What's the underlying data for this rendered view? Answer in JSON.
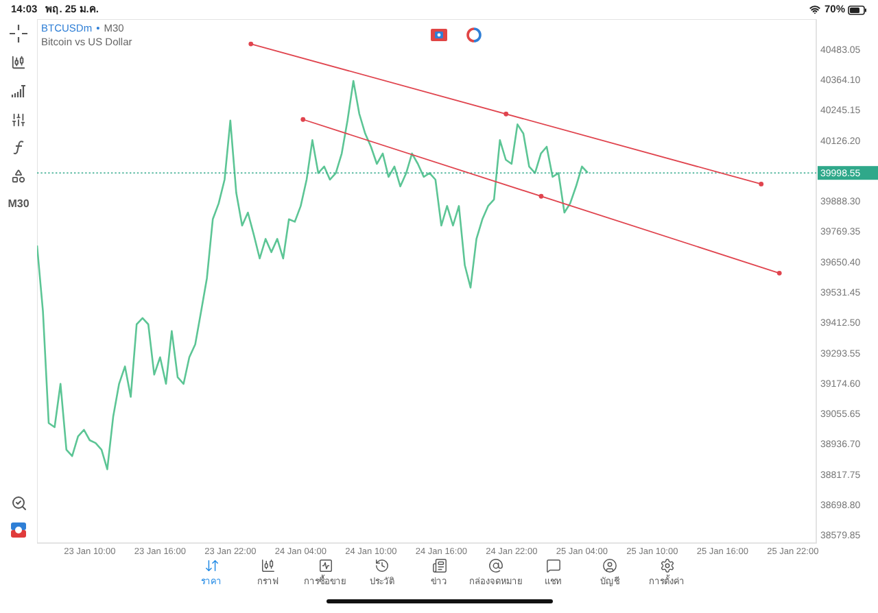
{
  "status_bar": {
    "time": "14:03",
    "date": "พฤ. 25 ม.ค.",
    "battery": "70%"
  },
  "toolbar": {
    "timeframe": "M30"
  },
  "chart": {
    "symbol": "BTCUSDm",
    "separator": "•",
    "period": "M30",
    "description": "Bitcoin vs US Dollar",
    "current_price": "39998.55",
    "chart_data": {
      "type": "line",
      "ylim": [
        38548,
        40601
      ],
      "yticks": [
        {
          "value": 40483.05,
          "label": "40483.05"
        },
        {
          "value": 40364.1,
          "label": "40364.10"
        },
        {
          "value": 40245.15,
          "label": "40245.15"
        },
        {
          "value": 40126.2,
          "label": "40126.20"
        },
        {
          "value": 39888.3,
          "label": "39888.30"
        },
        {
          "value": 39769.35,
          "label": "39769.35"
        },
        {
          "value": 39650.4,
          "label": "39650.40"
        },
        {
          "value": 39531.45,
          "label": "39531.45"
        },
        {
          "value": 39412.5,
          "label": "39412.50"
        },
        {
          "value": 39293.55,
          "label": "39293.55"
        },
        {
          "value": 39174.6,
          "label": "39174.60"
        },
        {
          "value": 39055.65,
          "label": "39055.65"
        },
        {
          "value": 38936.7,
          "label": "38936.70"
        },
        {
          "value": 38817.75,
          "label": "38817.75"
        },
        {
          "value": 38698.8,
          "label": "38698.80"
        },
        {
          "value": 38579.85,
          "label": "38579.85"
        }
      ],
      "categories": [
        null,
        null,
        null,
        null,
        null,
        null,
        null,
        null,
        null,
        "23 Jan 10:00",
        null,
        null,
        null,
        null,
        null,
        null,
        null,
        null,
        null,
        null,
        null,
        "23 Jan 16:00",
        null,
        null,
        null,
        null,
        null,
        null,
        null,
        null,
        null,
        null,
        null,
        "23 Jan 22:00",
        null,
        null,
        null,
        null,
        null,
        null,
        null,
        null,
        null,
        null,
        null,
        "24 Jan 04:00",
        null,
        null,
        null,
        null,
        null,
        null,
        null,
        null,
        null,
        null,
        null,
        "24 Jan 10:00",
        null,
        null,
        null,
        null,
        null,
        null,
        null,
        null,
        null,
        null,
        null,
        "24 Jan 16:00",
        null,
        null,
        null,
        null,
        null,
        null,
        null,
        null,
        null,
        null,
        null,
        "24 Jan 22:00",
        null,
        null,
        null,
        null,
        null,
        null,
        null,
        null,
        null,
        null,
        null,
        "25 Jan 04:00",
        null,
        null,
        null,
        null,
        null,
        null,
        null,
        null,
        null,
        null,
        null,
        "25 Jan 10:00",
        null,
        null,
        null,
        null,
        null,
        null,
        null,
        null,
        null,
        null,
        null,
        "25 Jan 16:00",
        null,
        null,
        null,
        null,
        null,
        null,
        null,
        null,
        null,
        null,
        null,
        "25 Jan 22:00",
        null,
        null,
        null,
        null
      ],
      "series": [
        {
          "color": "#5cc595",
          "values": [
            39714,
            39456,
            39018,
            39002,
            39172,
            38914,
            38889,
            38966,
            38992,
            38951,
            38940,
            38914,
            38837,
            39043,
            39172,
            39240,
            39121,
            39405,
            39430,
            39405,
            39208,
            39276,
            39172,
            39379,
            39198,
            39172,
            39276,
            39327,
            39456,
            39585,
            39817,
            39879,
            39972,
            40204,
            39921,
            39792,
            39843,
            39756,
            39663,
            39740,
            39688,
            39740,
            39663,
            39817,
            39807,
            39869,
            39972,
            40127,
            39998,
            40024,
            39972,
            39998,
            40075,
            40204,
            40359,
            40230,
            40153,
            40101,
            40034,
            40075,
            39983,
            40024,
            39946,
            39998,
            40075,
            40034,
            39983,
            39998,
            39972,
            39792,
            39869,
            39792,
            39869,
            39637,
            39549,
            39740,
            39817,
            39869,
            39895,
            40127,
            40050,
            40034,
            40189,
            40153,
            40024,
            39998,
            40075,
            40101,
            39983,
            39998,
            39843,
            39879,
            39946,
            40024,
            39999,
            null,
            null,
            null,
            null,
            null,
            null,
            null,
            null,
            null,
            null,
            null,
            null,
            null,
            null,
            null,
            null,
            null,
            null,
            null,
            null,
            null,
            null,
            null,
            null,
            null,
            null,
            null,
            null,
            null,
            null,
            null,
            null,
            null,
            null,
            null,
            null,
            null,
            null,
            null
          ]
        }
      ]
    },
    "trend_lines": [
      {
        "color": "#e0444e"
      },
      {
        "color": "#e0444e"
      }
    ]
  },
  "tabs": [
    {
      "label": "ราคา",
      "selected": true
    },
    {
      "label": "กราฟ",
      "selected": false
    },
    {
      "label": "การซื้อขาย",
      "selected": false
    },
    {
      "label": "ประวัติ",
      "selected": false
    },
    {
      "label": "ข่าว",
      "selected": false
    },
    {
      "label": "กล่องจดหมาย",
      "selected": false
    },
    {
      "label": "แชท",
      "selected": false
    },
    {
      "label": "บัญชี",
      "selected": false
    },
    {
      "label": "การตั้งค่า",
      "selected": false
    }
  ]
}
